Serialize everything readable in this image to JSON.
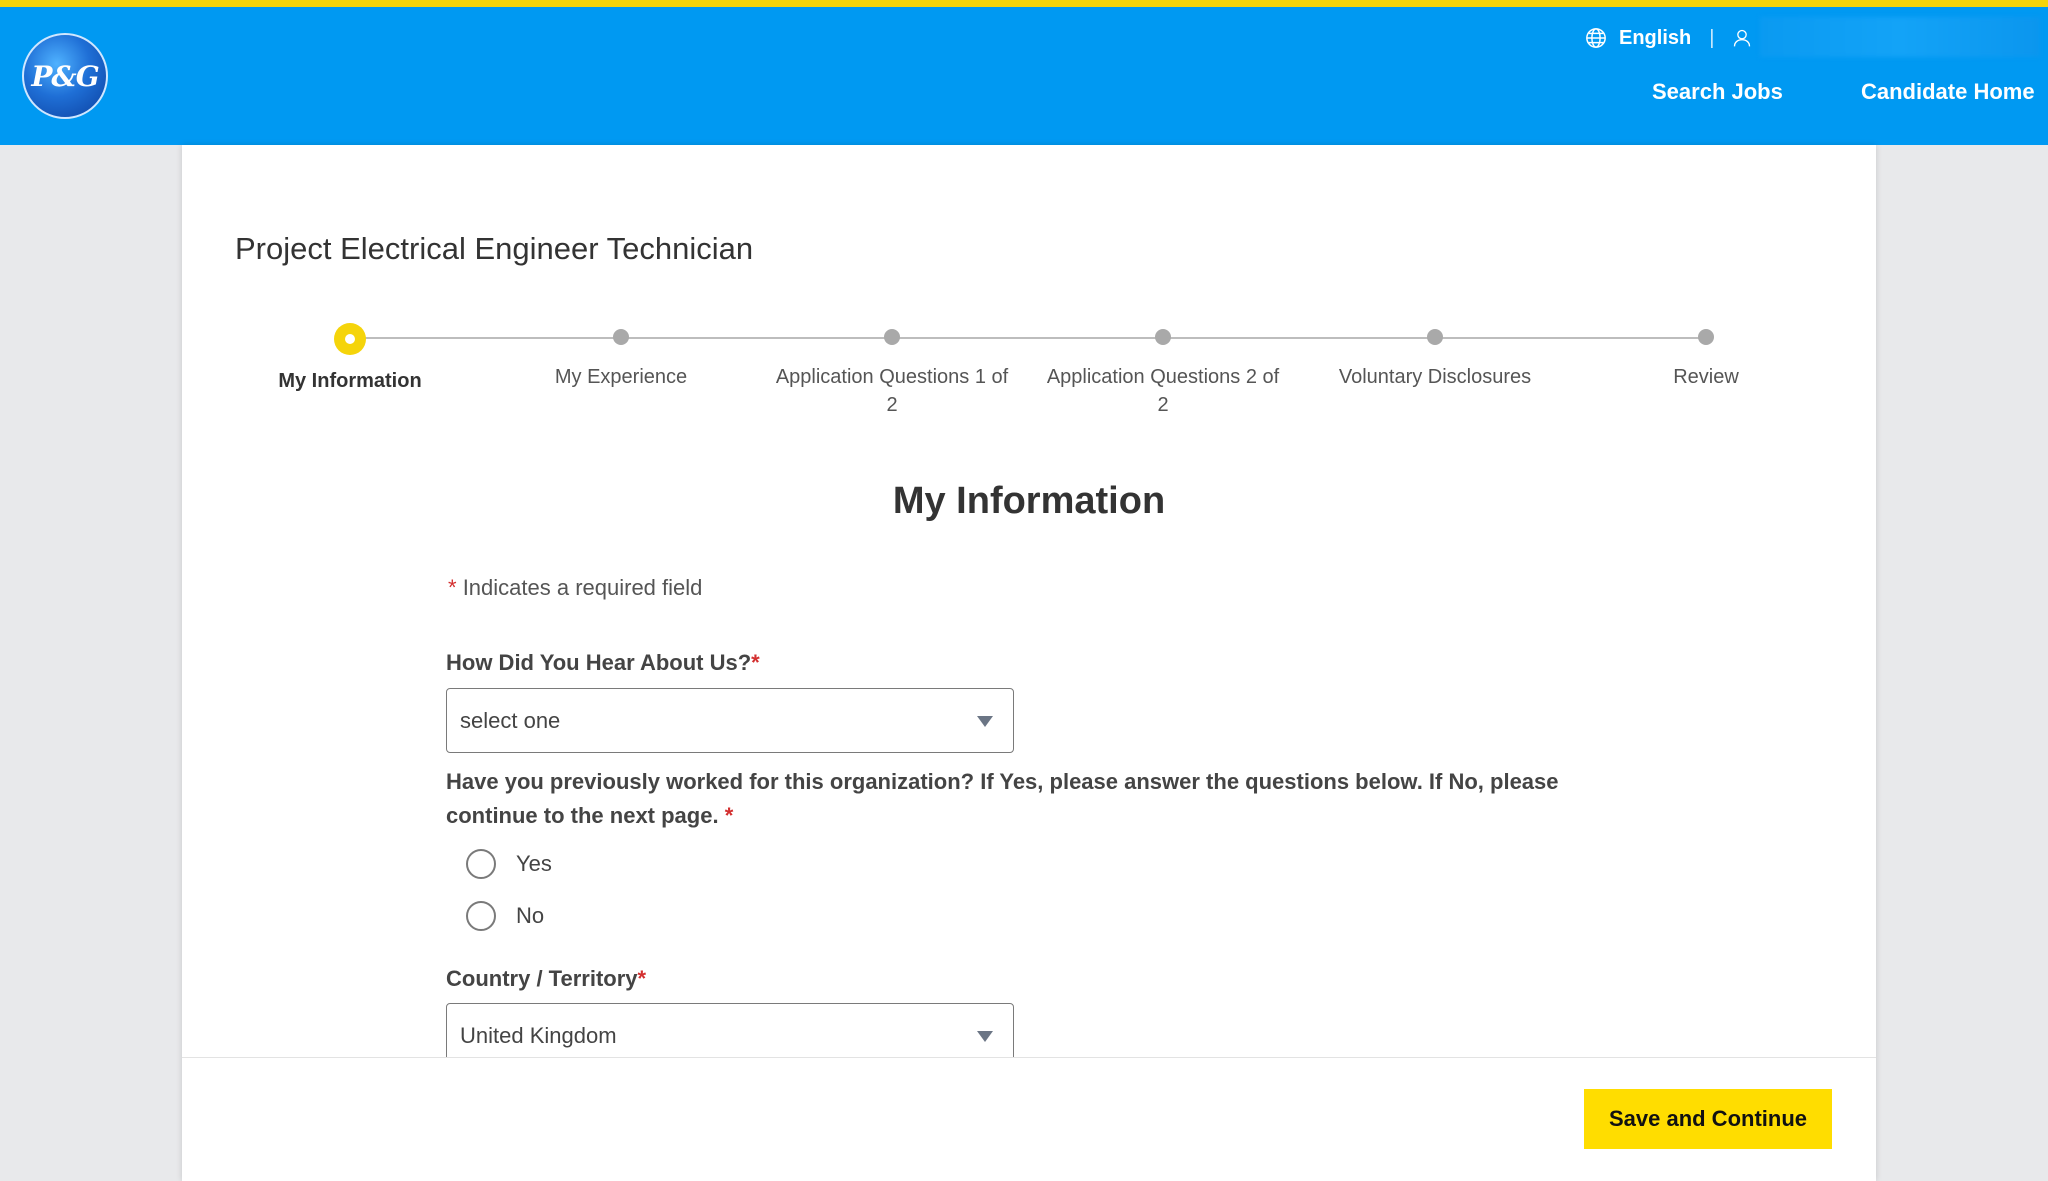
{
  "header": {
    "logo_text": "P&G",
    "language": "English",
    "nav": [
      "Search Jobs",
      "Candidate Home"
    ]
  },
  "job_title": "Project Electrical Engineer Technician",
  "steps": [
    {
      "label": "My Information",
      "active": true
    },
    {
      "label": "My Experience",
      "active": false
    },
    {
      "label": "Application Questions 1 of 2",
      "active": false
    },
    {
      "label": "Application Questions 2 of 2",
      "active": false
    },
    {
      "label": "Voluntary Disclosures",
      "active": false
    },
    {
      "label": "Review",
      "active": false
    }
  ],
  "section_title": "My Information",
  "required_note": "Indicates a required field",
  "required_marker": "*",
  "fields": {
    "hear_about": {
      "label": "How Did You Hear About Us?",
      "value": "select one"
    },
    "previously_worked": {
      "label": "Have you previously worked for this organization? If Yes, please answer the questions below. If No, please continue to the next page.",
      "options": [
        "Yes",
        "No"
      ]
    },
    "country": {
      "label": "Country / Territory",
      "value": "United Kingdom"
    }
  },
  "footer": {
    "save_label": "Save and Continue"
  },
  "colors": {
    "header_bg": "#0099f2",
    "accent_yellow": "#f5d40a",
    "button_yellow": "#ffdd00",
    "required_red": "#d32f2f"
  }
}
